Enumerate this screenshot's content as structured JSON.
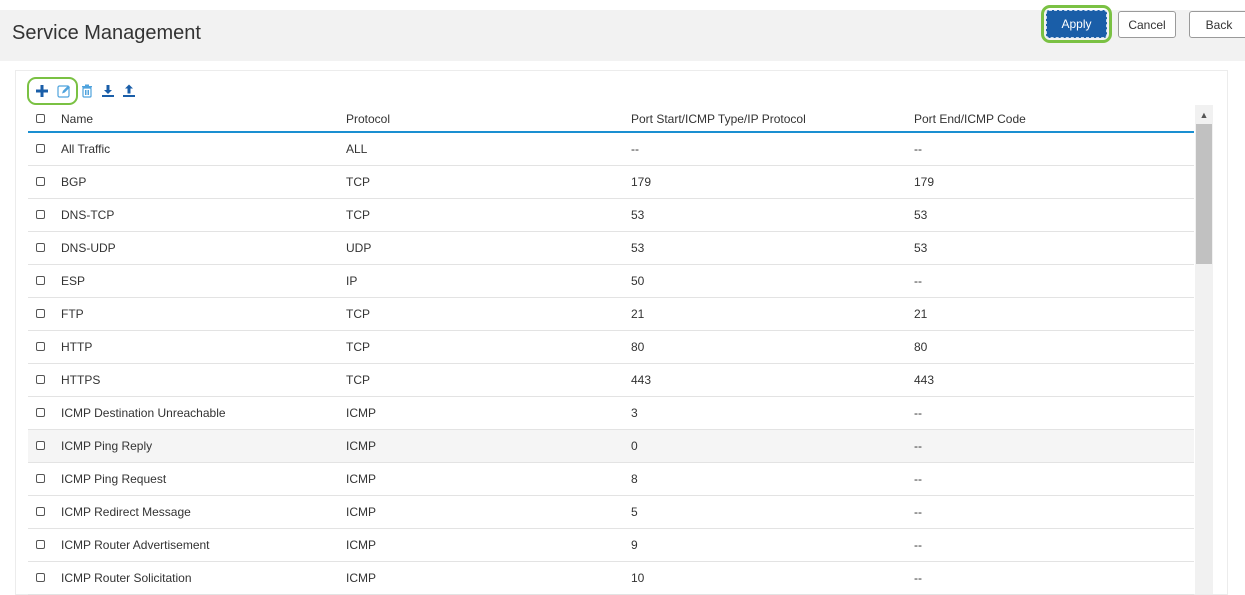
{
  "header": {
    "title": "Service Management",
    "apply_label": "Apply",
    "cancel_label": "Cancel",
    "back_label": "Back"
  },
  "toolbar": {
    "icons": [
      "add-icon",
      "edit-icon",
      "delete-icon",
      "import-icon",
      "export-icon"
    ]
  },
  "table": {
    "columns": [
      "Name",
      "Protocol",
      "Port Start/ICMP Type/IP Protocol",
      "Port End/ICMP Code"
    ],
    "rows": [
      {
        "name": "All Traffic",
        "protocol": "ALL",
        "start": "--",
        "end": "--"
      },
      {
        "name": "BGP",
        "protocol": "TCP",
        "start": "179",
        "end": "179"
      },
      {
        "name": "DNS-TCP",
        "protocol": "TCP",
        "start": "53",
        "end": "53"
      },
      {
        "name": "DNS-UDP",
        "protocol": "UDP",
        "start": "53",
        "end": "53"
      },
      {
        "name": "ESP",
        "protocol": "IP",
        "start": "50",
        "end": "--"
      },
      {
        "name": "FTP",
        "protocol": "TCP",
        "start": "21",
        "end": "21"
      },
      {
        "name": "HTTP",
        "protocol": "TCP",
        "start": "80",
        "end": "80"
      },
      {
        "name": "HTTPS",
        "protocol": "TCP",
        "start": "443",
        "end": "443"
      },
      {
        "name": "ICMP Destination Unreachable",
        "protocol": "ICMP",
        "start": "3",
        "end": "--"
      },
      {
        "name": "ICMP Ping Reply",
        "protocol": "ICMP",
        "start": "0",
        "end": "--"
      },
      {
        "name": "ICMP Ping Request",
        "protocol": "ICMP",
        "start": "8",
        "end": "--"
      },
      {
        "name": "ICMP Redirect Message",
        "protocol": "ICMP",
        "start": "5",
        "end": "--"
      },
      {
        "name": "ICMP Router Advertisement",
        "protocol": "ICMP",
        "start": "9",
        "end": "--"
      },
      {
        "name": "ICMP Router Solicitation",
        "protocol": "ICMP",
        "start": "10",
        "end": "--"
      }
    ]
  },
  "colors": {
    "accent": "#1a8fd1",
    "apply_bg": "#1a5ea8",
    "highlight": "#7ac143"
  }
}
